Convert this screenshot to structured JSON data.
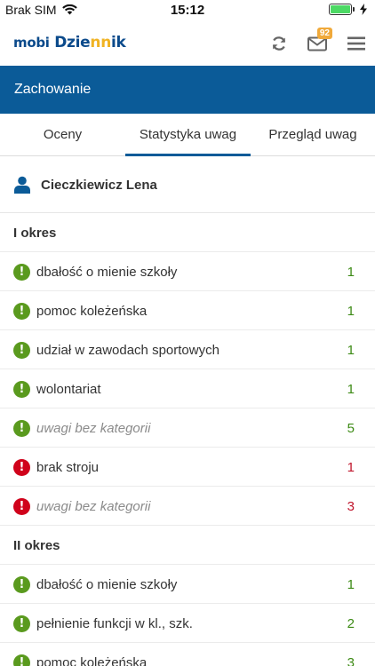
{
  "status_bar": {
    "carrier": "Brak SIM",
    "time": "15:12"
  },
  "header": {
    "logo": {
      "part1": "mobi",
      "part2": "Dzie",
      "part3": "nn",
      "part4": "ik"
    },
    "mail_badge": "92",
    "icons": [
      "refresh-icon",
      "mail-icon",
      "menu-icon"
    ]
  },
  "title_bar": {
    "title": "Zachowanie"
  },
  "tabs": [
    {
      "label": "Oceny"
    },
    {
      "label": "Statystyka uwag",
      "active": true
    },
    {
      "label": "Przegląd uwag"
    }
  ],
  "student": {
    "name": "Cieczkiewicz Lena"
  },
  "colors": {
    "primary": "#0b5b98",
    "positive": "#5a9a1e",
    "negative": "#d0021b",
    "badge": "#f0a93a"
  },
  "sections": [
    {
      "title": "I okres",
      "items": [
        {
          "label": "dbałość o mienie szkoły",
          "count": "1",
          "type": "positive",
          "italic": false
        },
        {
          "label": "pomoc koleżeńska",
          "count": "1",
          "type": "positive",
          "italic": false
        },
        {
          "label": "udział w zawodach sportowych",
          "count": "1",
          "type": "positive",
          "italic": false
        },
        {
          "label": "wolontariat",
          "count": "1",
          "type": "positive",
          "italic": false
        },
        {
          "label": "uwagi bez kategorii",
          "count": "5",
          "type": "positive",
          "italic": true
        },
        {
          "label": "brak stroju",
          "count": "1",
          "type": "negative",
          "italic": false
        },
        {
          "label": "uwagi bez kategorii",
          "count": "3",
          "type": "negative",
          "italic": true
        }
      ]
    },
    {
      "title": "II okres",
      "items": [
        {
          "label": "dbałość o mienie szkoły",
          "count": "1",
          "type": "positive",
          "italic": false
        },
        {
          "label": "pełnienie funkcji w kl., szk.",
          "count": "2",
          "type": "positive",
          "italic": false
        },
        {
          "label": "pomoc koleżeńska",
          "count": "3",
          "type": "positive",
          "italic": false
        }
      ]
    }
  ]
}
